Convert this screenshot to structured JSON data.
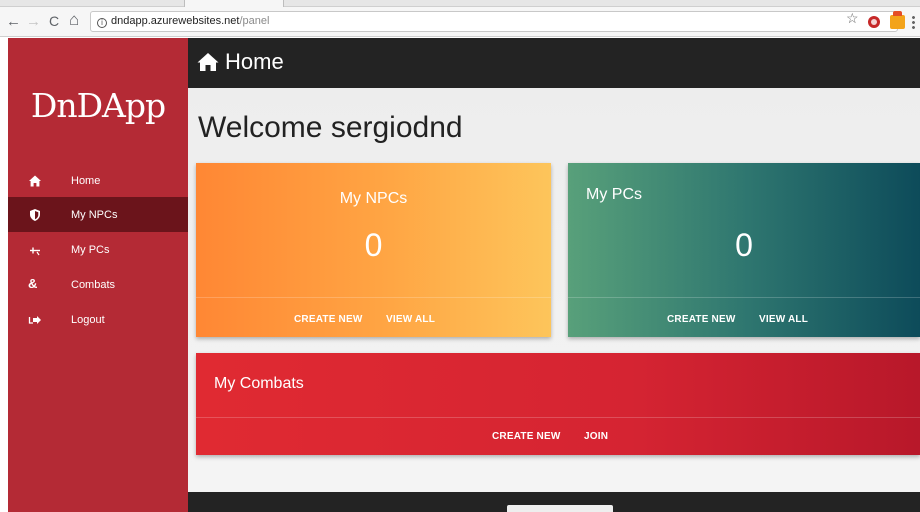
{
  "browser": {
    "url_host": "dndapp.azurewebsites.net",
    "url_path": "/panel",
    "back_glyph": "←",
    "forward_glyph": "→",
    "reload_glyph": "C",
    "home_glyph": "⌂",
    "info_glyph": "i",
    "star_glyph": "☆"
  },
  "sidebar": {
    "logo": "DnDApp",
    "accent": "#b42a35",
    "active_bg": "#6b141b",
    "items": [
      {
        "label": "Home",
        "icon": "home-icon"
      },
      {
        "label": "My NPCs",
        "icon": "shield-icon",
        "active": true
      },
      {
        "label": "My PCs",
        "icon": "sword-icon"
      },
      {
        "label": "Combats",
        "icon": "ampersand-icon"
      },
      {
        "label": "Logout",
        "icon": "logout-icon"
      }
    ],
    "combats_glyph": "&"
  },
  "header": {
    "title": "Home",
    "icon": "home-icon"
  },
  "main": {
    "welcome": "Welcome sergiodnd",
    "cards": {
      "npcs": {
        "title": "My NPCs",
        "count": "0",
        "create": "CREATE NEW",
        "view": "VIEW ALL"
      },
      "pcs": {
        "title": "My PCs",
        "count": "0",
        "create": "CREATE NEW",
        "view": "VIEW ALL"
      },
      "combats": {
        "title": "My Combats",
        "create": "CREATE NEW",
        "join": "JOIN"
      }
    }
  }
}
